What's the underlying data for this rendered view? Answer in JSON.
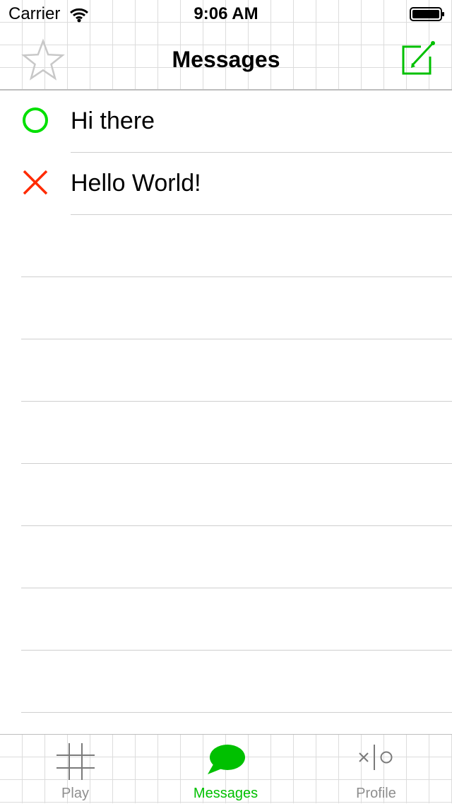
{
  "status_bar": {
    "carrier": "Carrier",
    "time": "9:06 AM"
  },
  "nav": {
    "title": "Messages",
    "left_icon": "star-icon",
    "right_icon": "compose-icon"
  },
  "messages": [
    {
      "text": "Hi there",
      "icon": "circle-o-icon",
      "icon_color": "#00e000"
    },
    {
      "text": "Hello World!",
      "icon": "x-icon",
      "icon_color": "#ff2a00"
    }
  ],
  "tabbar": {
    "tabs": [
      {
        "label": "Play",
        "icon": "grid-icon",
        "active": false
      },
      {
        "label": "Messages",
        "icon": "chat-bubble-icon",
        "active": true
      },
      {
        "label": "Profile",
        "icon": "x-o-icon",
        "active": false
      }
    ]
  },
  "colors": {
    "accent": "#00c000",
    "x_red": "#ff2a00",
    "grid": "#dcdcdc"
  }
}
